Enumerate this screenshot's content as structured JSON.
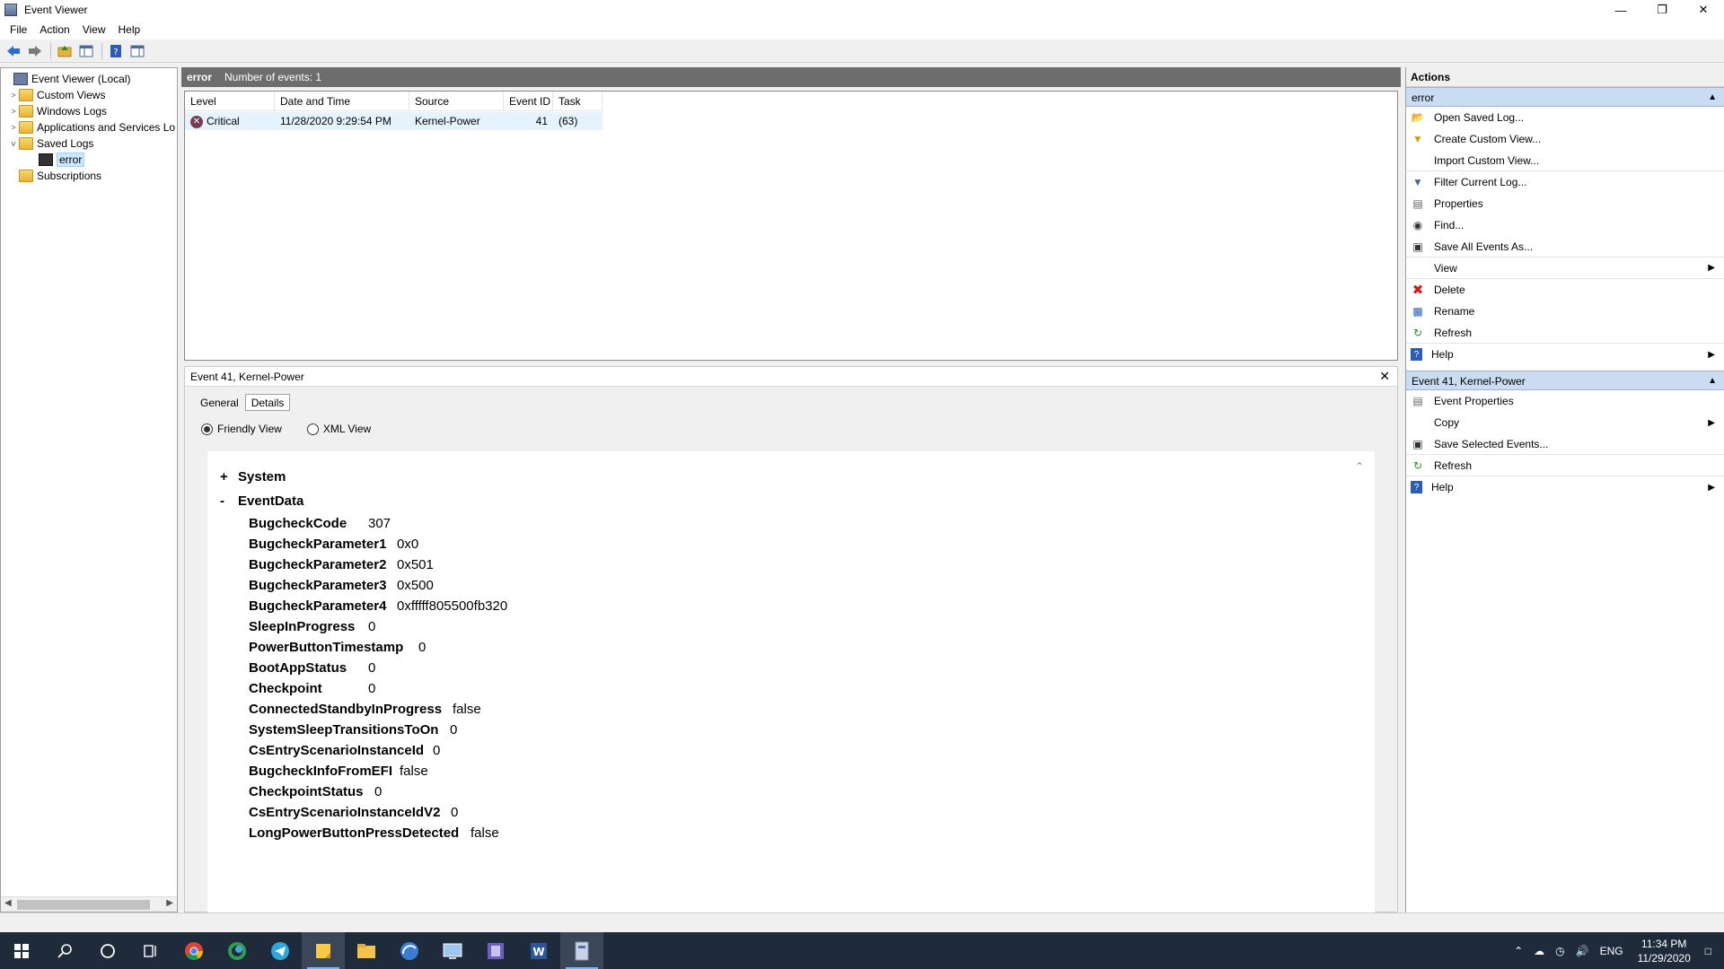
{
  "window": {
    "title": "Event Viewer"
  },
  "menu": [
    "File",
    "Action",
    "View",
    "Help"
  ],
  "tree": [
    {
      "label": "Event Viewer (Local)",
      "expander": "",
      "icon": "ev"
    },
    {
      "label": "Custom Views",
      "expander": ">",
      "icon": "folder"
    },
    {
      "label": "Windows Logs",
      "expander": ">",
      "icon": "folder"
    },
    {
      "label": "Applications and Services Lo",
      "expander": ">",
      "icon": "folder"
    },
    {
      "label": "Saved Logs",
      "expander": "v",
      "icon": "folder"
    },
    {
      "label": "error",
      "expander": "",
      "icon": "save"
    },
    {
      "label": "Subscriptions",
      "expander": "",
      "icon": "folder"
    }
  ],
  "log_header": {
    "name": "error",
    "count_text": "Number of events: 1"
  },
  "events_table": {
    "columns": [
      "Level",
      "Date and Time",
      "Source",
      "Event ID",
      "Task Ca..."
    ],
    "rows": [
      {
        "level": "Critical",
        "datetime": "11/28/2020 9:29:54 PM",
        "source": "Kernel-Power",
        "event_id": "41",
        "task": "(63)"
      }
    ]
  },
  "detail": {
    "title": "Event 41, Kernel-Power",
    "tabs": [
      "General",
      "Details"
    ],
    "view_options": [
      "Friendly View",
      "XML View"
    ],
    "system_sign": "+",
    "system_label": "System",
    "eventdata_sign": "-",
    "eventdata_label": "EventData",
    "fields": [
      {
        "k": "BugcheckCode",
        "v": "307"
      },
      {
        "k": "BugcheckParameter1",
        "v": "0x0"
      },
      {
        "k": "BugcheckParameter2",
        "v": "0x501"
      },
      {
        "k": "BugcheckParameter3",
        "v": "0x500"
      },
      {
        "k": "BugcheckParameter4",
        "v": "0xfffff805500fb320"
      },
      {
        "k": "SleepInProgress",
        "v": "0"
      },
      {
        "k": "PowerButtonTimestamp",
        "v": "0"
      },
      {
        "k": "BootAppStatus",
        "v": "0"
      },
      {
        "k": "Checkpoint",
        "v": "0"
      },
      {
        "k": "ConnectedStandbyInProgress",
        "v": "false"
      },
      {
        "k": "SystemSleepTransitionsToOn",
        "v": "0"
      },
      {
        "k": "CsEntryScenarioInstanceId",
        "v": "0"
      },
      {
        "k": "BugcheckInfoFromEFI",
        "v": "false"
      },
      {
        "k": "CheckpointStatus",
        "v": "0"
      },
      {
        "k": "CsEntryScenarioInstanceIdV2",
        "v": "0"
      },
      {
        "k": "LongPowerButtonPressDetected",
        "v": "false"
      }
    ]
  },
  "actions": {
    "title": "Actions",
    "section1": "error",
    "section1_items": [
      {
        "label": "Open Saved Log...",
        "icon": "open-folder-icon",
        "sub": false
      },
      {
        "label": "Create Custom View...",
        "icon": "filter-icon",
        "sub": false
      },
      {
        "label": "Import Custom View...",
        "icon": "",
        "sub": false
      },
      {
        "label": "Filter Current Log...",
        "icon": "filter-icon",
        "sub": false
      },
      {
        "label": "Properties",
        "icon": "properties-icon",
        "sub": false
      },
      {
        "label": "Find...",
        "icon": "find-icon",
        "sub": false
      },
      {
        "label": "Save All Events As...",
        "icon": "save-icon",
        "sub": false
      },
      {
        "label": "View",
        "icon": "",
        "sub": true
      },
      {
        "label": "Delete",
        "icon": "delete-icon",
        "sub": false
      },
      {
        "label": "Rename",
        "icon": "rename-icon",
        "sub": false
      },
      {
        "label": "Refresh",
        "icon": "refresh-icon",
        "sub": false
      },
      {
        "label": "Help",
        "icon": "help-icon",
        "sub": true
      }
    ],
    "section2": "Event 41, Kernel-Power",
    "section2_items": [
      {
        "label": "Event Properties",
        "icon": "properties-icon",
        "sub": false
      },
      {
        "label": "Copy",
        "icon": "copy-icon",
        "sub": true
      },
      {
        "label": "Save Selected Events...",
        "icon": "save-icon",
        "sub": false
      },
      {
        "label": "Refresh",
        "icon": "refresh-icon",
        "sub": false
      },
      {
        "label": "Help",
        "icon": "help-icon",
        "sub": true
      }
    ]
  },
  "taskbar": {
    "lang": "ENG",
    "time": "11:34 PM",
    "date": "11/29/2020"
  }
}
